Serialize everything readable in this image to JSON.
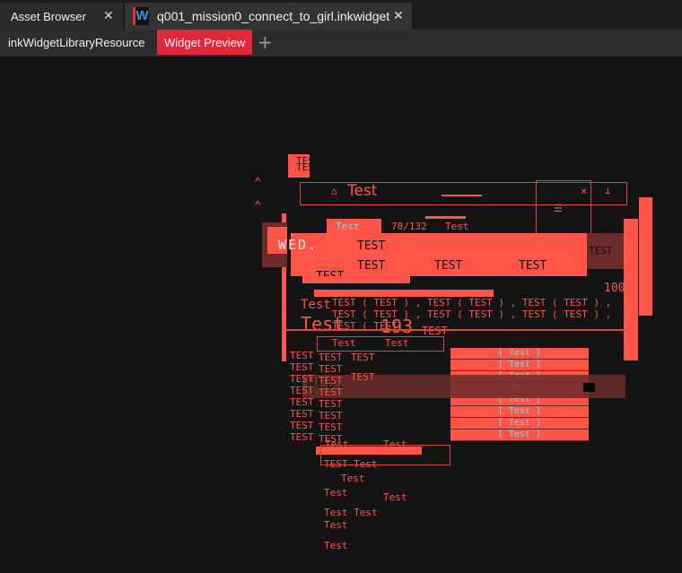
{
  "tabs": [
    {
      "label": "Asset Browser",
      "close_icon": "close-icon"
    },
    {
      "label": "q001_mission0_connect_to_girl.inkwidget",
      "icon": "W",
      "close_icon": "close-icon"
    }
  ],
  "subtabs": [
    {
      "label": "inkWidgetLibraryResource",
      "active": false
    },
    {
      "label": "Widget Preview",
      "active": true
    }
  ],
  "add_tab_icon": "+",
  "close_glyph": "✕",
  "accent_color": "#e0283a",
  "widget_color": "#ff5448",
  "preview": {
    "header_title": "Test",
    "tab_label": "Test",
    "counter": "78/132",
    "tab_label_right": "Test",
    "logo": "WED.",
    "number_193": "193",
    "number_100": "100",
    "test_upper": "TEST",
    "test_title": "Test",
    "list_line_1": "TEST ( TEST ) , TEST ( TEST ) , TEST ( TEST ) ,",
    "list_line_2": "TEST ( TEST ) , TEST ( TEST ) , TEST ( TEST ) ,",
    "list_line_3": "TEST ( TEST",
    "bracket_items": [
      "[ Test ]",
      "[ Test ]",
      "[ Test ]",
      "[ Test ]",
      "[ Test ]",
      "[ Test ]",
      "[ Test ]",
      "[ Test ]"
    ],
    "left_column": [
      "TEST",
      "TEST",
      "TEST",
      "TEST",
      "TEST",
      "TEST",
      "TEST",
      "TEST"
    ],
    "mid_column": [
      "TEST",
      "TEST",
      "TEST",
      "TEST",
      "TEST",
      "TEST",
      "TEST",
      "TEST",
      "Test"
    ],
    "lower_tests": [
      "Test",
      "Test",
      "TEST Test",
      "Test",
      "Test",
      "Test",
      "Test Test",
      "Test",
      "Test"
    ]
  }
}
